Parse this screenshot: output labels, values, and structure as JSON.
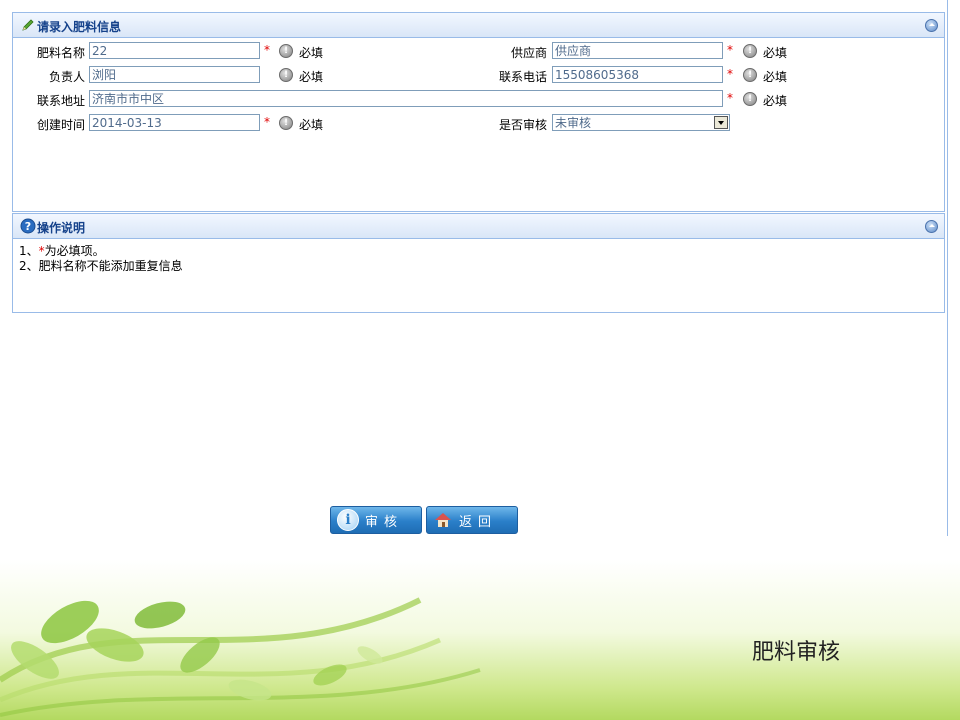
{
  "form_panel": {
    "title": "请录入肥料信息",
    "fields": {
      "name": {
        "label": "肥料名称",
        "value": "22"
      },
      "supplier": {
        "label": "供应商",
        "value": "供应商"
      },
      "manager": {
        "label": "负责人",
        "value": "浏阳"
      },
      "phone": {
        "label": "联系电话",
        "value": "15508605368"
      },
      "address": {
        "label": "联系地址",
        "value": "济南市市中区"
      },
      "created": {
        "label": "创建时间",
        "value": "2014-03-13"
      },
      "audited": {
        "label": "是否审核",
        "value": "未审核"
      }
    },
    "required_star": "*",
    "required_text": "必填"
  },
  "help_panel": {
    "title": "操作说明",
    "line1_prefix": "1、",
    "line1_star": "*",
    "line1_suffix": "为必填项。",
    "line2": "2、肥料名称不能添加重复信息"
  },
  "buttons": {
    "audit": "审核",
    "back": "返回"
  },
  "footer": {
    "title": "肥料审核"
  },
  "colors": {
    "panel_border": "#99bbe8",
    "header_text": "#15428b",
    "required": "#e00000",
    "button": "#2a7fc9"
  }
}
